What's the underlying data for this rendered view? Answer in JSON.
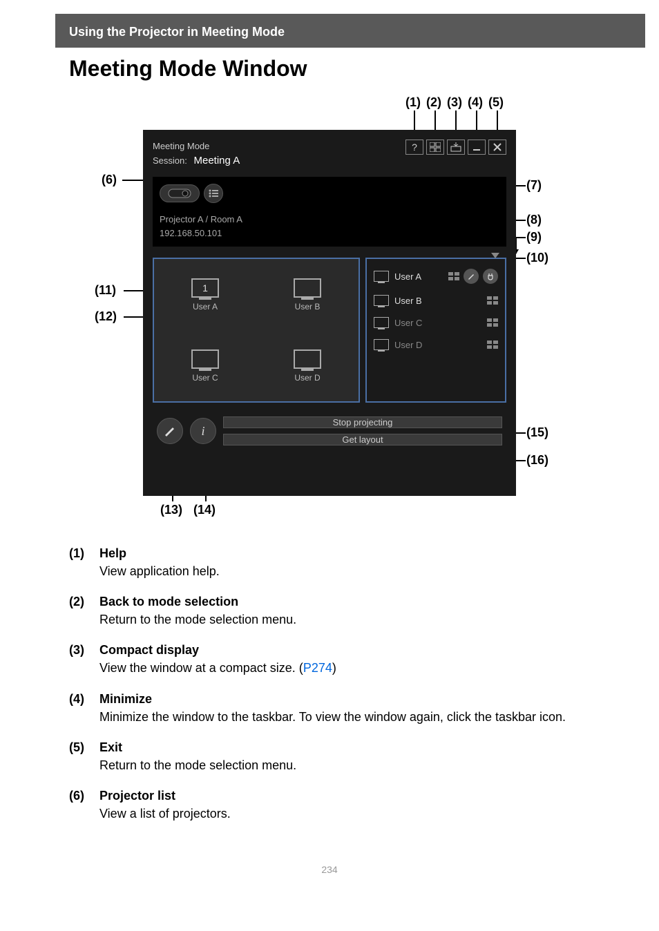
{
  "header": {
    "section": "Using the Projector in Meeting Mode"
  },
  "title": "Meeting Mode Window",
  "app": {
    "window_title": "Meeting Mode",
    "session_label": "Session:",
    "session_name": "Meeting A",
    "projector_name": "Projector A / Room A",
    "projector_ip": "192.168.50.101",
    "cells": [
      {
        "num": "1",
        "label": "User A"
      },
      {
        "num": "",
        "label": "User B"
      },
      {
        "num": "",
        "label": "User C"
      },
      {
        "num": "",
        "label": "User D"
      }
    ],
    "users": [
      {
        "label": "User A",
        "active": true,
        "extras": true
      },
      {
        "label": "User B",
        "active": true,
        "extras": false
      },
      {
        "label": "User C",
        "active": false,
        "extras": false
      },
      {
        "label": "User D",
        "active": false,
        "extras": false
      }
    ],
    "stop_btn": "Stop projecting",
    "layout_btn": "Get layout"
  },
  "callouts": {
    "top": [
      "(1)",
      "(2)",
      "(3)",
      "(4)",
      "(5)"
    ],
    "left": {
      "c6": "(6)",
      "c11": "(11)",
      "c12": "(12)"
    },
    "right": {
      "c7": "(7)",
      "c8": "(8)",
      "c9": "(9)",
      "c10": "(10)",
      "c15": "(15)",
      "c16": "(16)"
    },
    "bottom": {
      "c13": "(13)",
      "c14": "(14)"
    }
  },
  "descriptions": [
    {
      "n": "(1)",
      "t": "Help",
      "d": "View application help."
    },
    {
      "n": "(2)",
      "t": "Back to mode selection",
      "d": "Return to the mode selection menu."
    },
    {
      "n": "(3)",
      "t": "Compact display",
      "d_pre": "View the window at a compact size. (",
      "link": "P274",
      "d_post": ")"
    },
    {
      "n": "(4)",
      "t": "Minimize",
      "d": "Minimize the window to the taskbar. To view the window again, click the taskbar icon."
    },
    {
      "n": "(5)",
      "t": "Exit",
      "d": "Return to the mode selection menu."
    },
    {
      "n": "(6)",
      "t": "Projector list",
      "d": "View a list of projectors."
    }
  ],
  "page_number": "234"
}
